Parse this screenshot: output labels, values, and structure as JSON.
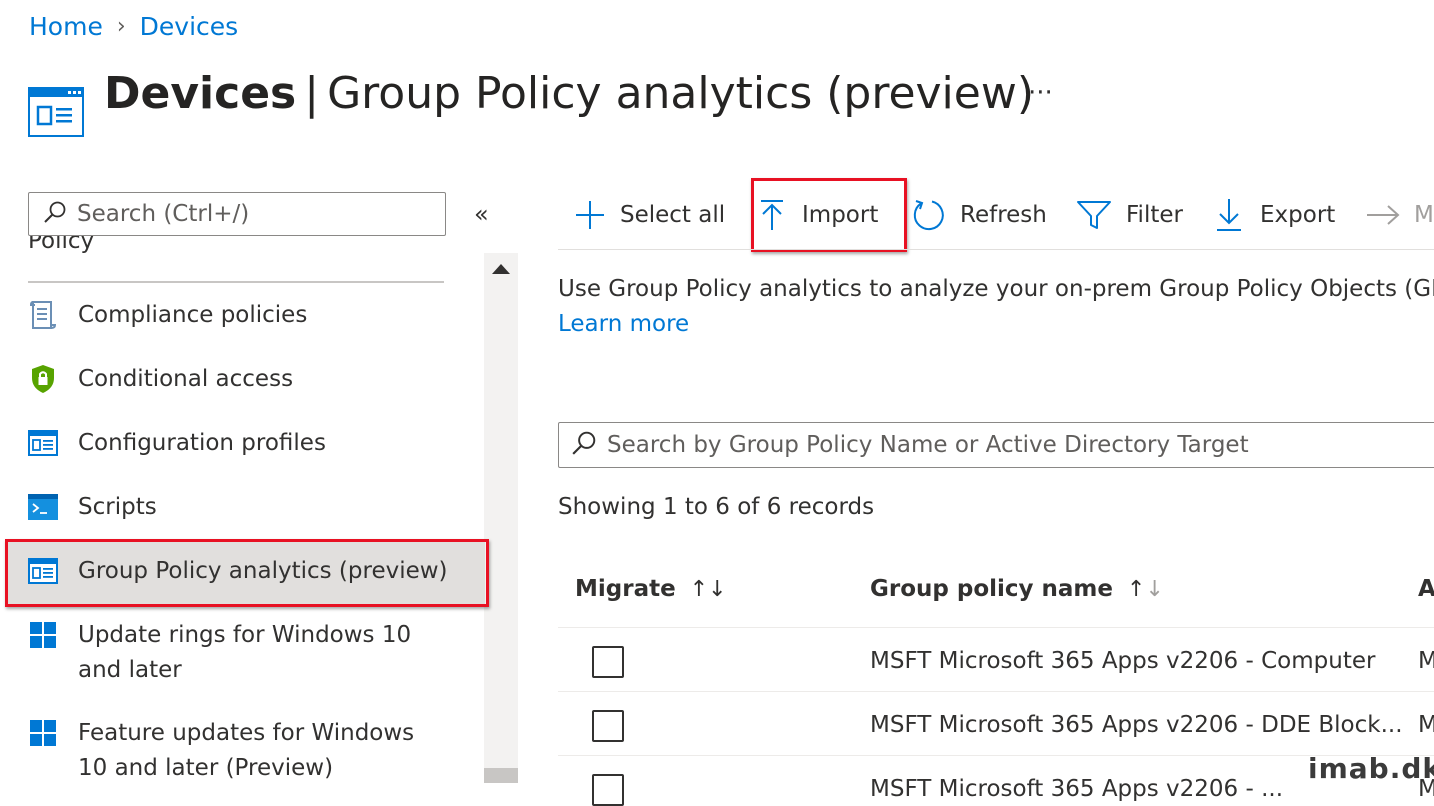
{
  "breadcrumb": {
    "home": "Home",
    "separator": "›",
    "devices": "Devices"
  },
  "header": {
    "title_bold": "Devices",
    "title_rest": "Group Policy analytics (preview)",
    "more": "···",
    "icon": "devices-blade-icon"
  },
  "sidebar": {
    "search_placeholder": "Search (Ctrl+/)",
    "collapse": "«",
    "partial_heading": "Policy",
    "items": [
      {
        "label": "Compliance policies",
        "icon": "compliance-icon"
      },
      {
        "label": "Conditional access",
        "icon": "shield-lock-icon"
      },
      {
        "label": "Configuration profiles",
        "icon": "config-profile-icon"
      },
      {
        "label": "Scripts",
        "icon": "terminal-icon"
      },
      {
        "label": "Group Policy analytics (preview)",
        "icon": "gpa-icon",
        "selected": true
      },
      {
        "label_line1": "Update rings for Windows 10",
        "label_line2": "and later",
        "icon": "windows-icon"
      },
      {
        "label_line1": "Feature updates for Windows",
        "label_line2": "10 and later (Preview)",
        "icon": "windows-icon"
      }
    ]
  },
  "toolbar": {
    "select_all": "Select all",
    "import": "Import",
    "refresh": "Refresh",
    "filter": "Filter",
    "export": "Export",
    "migrate_partial": "M"
  },
  "main": {
    "description": "Use Group Policy analytics to analyze your on-prem Group Policy Objects (GP",
    "learn_more": "Learn more",
    "search_placeholder": "Search by Group Policy Name or Active Directory Target",
    "records": "Showing 1 to 6 of 6 records"
  },
  "table": {
    "headers": {
      "migrate": "Migrate",
      "name": "Group policy name",
      "partial": "A"
    },
    "rows": [
      {
        "name": "MSFT Microsoft 365 Apps v2206 - Computer",
        "partial": "M"
      },
      {
        "name": "MSFT Microsoft 365 Apps v2206 - DDE Block...",
        "partial": "M"
      },
      {
        "name": "MSFT Microsoft 365 Apps v2206 - ...",
        "partial": "M"
      }
    ]
  },
  "watermark": "imab.dk",
  "colors": {
    "accent": "#0078d4",
    "highlight_box": "#e81123",
    "selected_bg": "#e1dfdd",
    "shield": "#57a300"
  }
}
